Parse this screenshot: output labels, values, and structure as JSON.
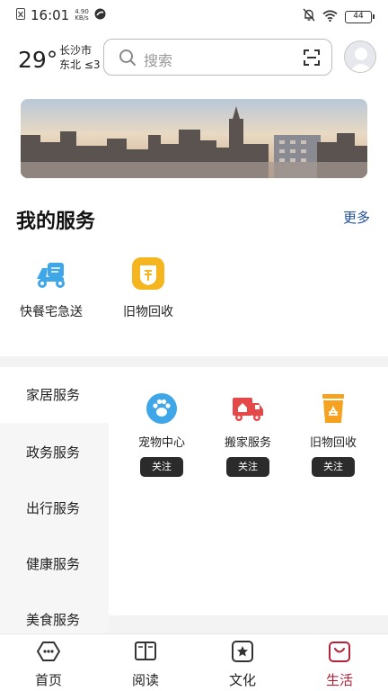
{
  "status_bar": {
    "time": "16:01",
    "speed_value": "4.90",
    "speed_unit": "KB/s",
    "battery": "44"
  },
  "header": {
    "temperature": "29°",
    "city": "长沙市",
    "wind": "东北 ≤3",
    "search_placeholder": "搜索"
  },
  "my_services": {
    "title": "我的服务",
    "more_label": "更多",
    "items": [
      {
        "label": "快餐宅急送",
        "icon": "delivery-scooter-icon",
        "color": "#3fa7e8"
      },
      {
        "label": "旧物回收",
        "icon": "recycle-badge-icon",
        "color": "#f4b51f"
      }
    ]
  },
  "categories": {
    "sidebar": [
      {
        "label": "家居服务",
        "active": true
      },
      {
        "label": "政务服务",
        "active": false
      },
      {
        "label": "出行服务",
        "active": false
      },
      {
        "label": "健康服务",
        "active": false
      },
      {
        "label": "美食服务",
        "active": false
      }
    ],
    "items": [
      {
        "label": "宠物中心",
        "button": "关注",
        "icon": "paw-icon",
        "color": "#3fa7e8"
      },
      {
        "label": "搬家服务",
        "button": "关注",
        "icon": "moving-truck-icon",
        "color": "#e54848"
      },
      {
        "label": "旧物回收",
        "button": "关注",
        "icon": "recycle-bin-icon",
        "color": "#f4a21f"
      }
    ]
  },
  "bottom_nav": [
    {
      "label": "首页",
      "icon": "home-hexagon-icon",
      "active": false
    },
    {
      "label": "阅读",
      "icon": "book-icon",
      "active": false
    },
    {
      "label": "文化",
      "icon": "star-square-icon",
      "active": false
    },
    {
      "label": "生活",
      "icon": "bag-smile-icon",
      "active": true
    }
  ],
  "colors": {
    "accent_active": "#b3243a",
    "link_blue": "#1f4f9a",
    "button_dark": "#2b2b2b"
  }
}
